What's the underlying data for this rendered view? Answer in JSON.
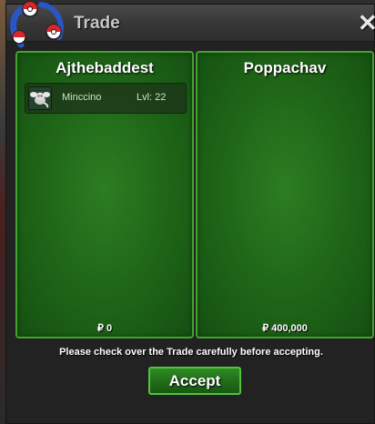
{
  "window": {
    "title": "Trade",
    "close_label": "✕"
  },
  "left_panel": {
    "player_name": "Ajthebaddest",
    "items": [
      {
        "name": "Minccino",
        "level": "Lvl: 22"
      }
    ],
    "money": "₽ 0"
  },
  "right_panel": {
    "player_name": "Poppachav",
    "items": [],
    "money": "₽ 400,000"
  },
  "notice": "Please check over the Trade carefully before accepting.",
  "accept_label": "Accept",
  "colors": {
    "panel_green": "#1e6417",
    "panel_border": "#44a32f",
    "button_border": "#55c23c",
    "pokeball_red": "#d9262b",
    "logo_blue": "#2a55c4"
  },
  "icons": {
    "window_logo": "pokeball-logo-icon",
    "pokemon": "minccino-icon"
  }
}
